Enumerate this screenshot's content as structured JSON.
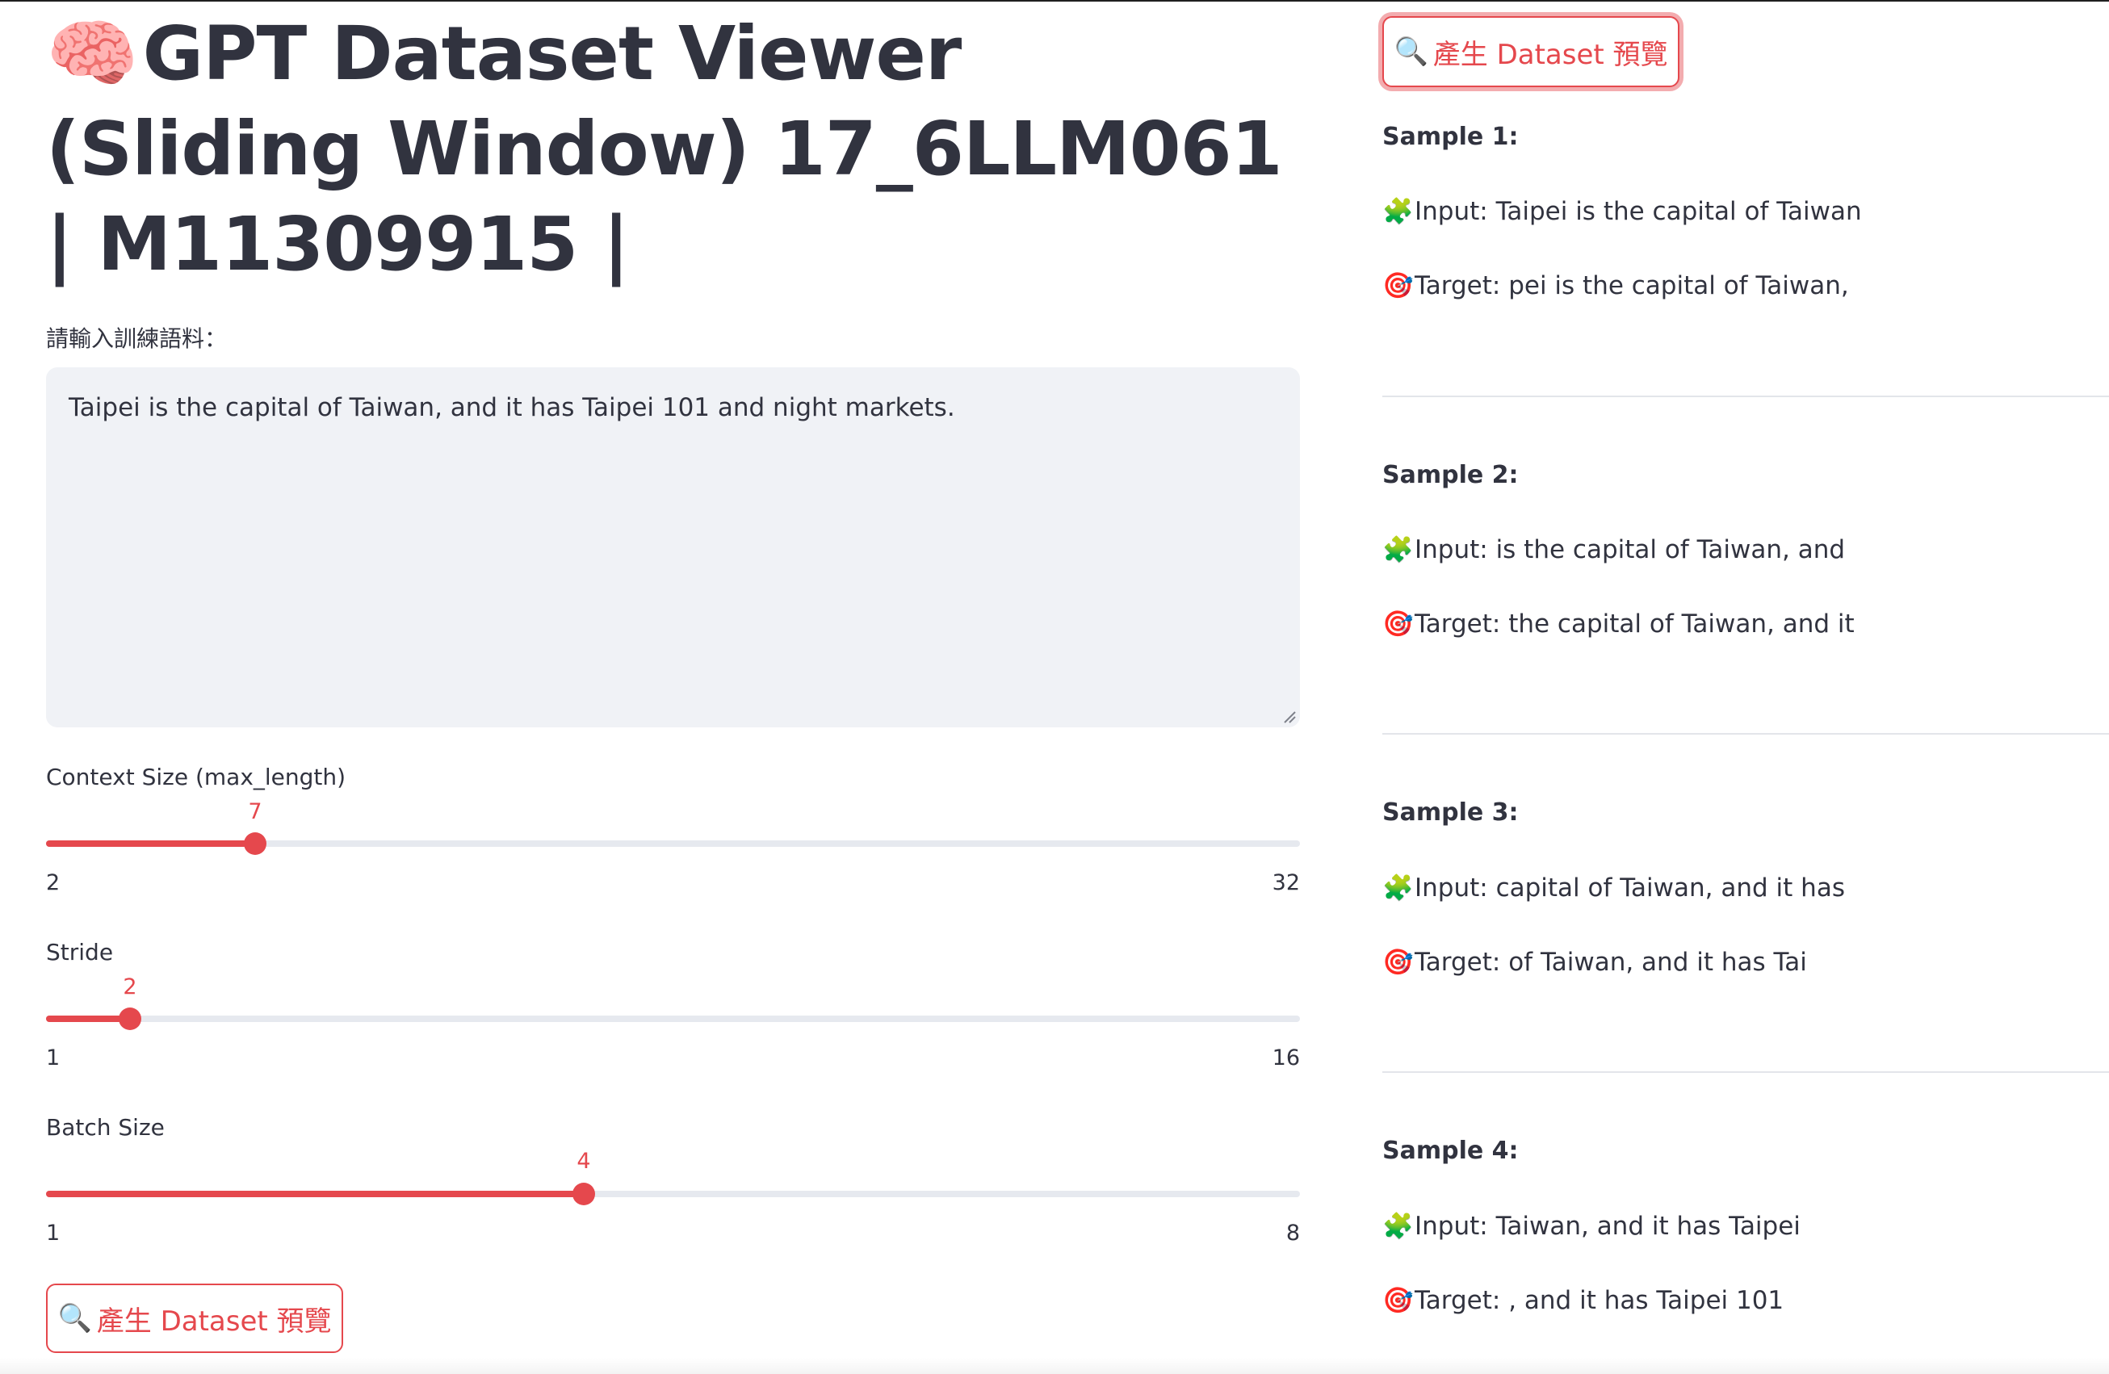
{
  "title": {
    "emoji": "🧠",
    "text": "GPT Dataset Viewer (Sliding Window) 17_6LLM061 | M11309915 |"
  },
  "input": {
    "label": "請輸入訓練語料：",
    "value": "Taipei is the capital of Taiwan, and it has Taipei 101 and night markets."
  },
  "sliders": [
    {
      "label": "Context Size (max_length)",
      "value": 7,
      "min": 2,
      "max": 32,
      "value_text": "7",
      "min_text": "2",
      "max_text": "32"
    },
    {
      "label": "Stride",
      "value": 2,
      "min": 1,
      "max": 16,
      "value_text": "2",
      "min_text": "1",
      "max_text": "16"
    },
    {
      "label": "Batch Size",
      "value": 4,
      "min": 1,
      "max": 8,
      "value_text": "4",
      "min_text": "1",
      "max_text": "8"
    }
  ],
  "buttons": {
    "generate_icon": "🔍",
    "generate_label": "產生 Dataset 預覽"
  },
  "samples": [
    {
      "title": "Sample 1:",
      "input": "Input: Taipei is the capital of Taiwan",
      "target": "Target: pei is the capital of Taiwan,"
    },
    {
      "title": "Sample 2:",
      "input": "Input: is the capital of Taiwan, and",
      "target": "Target: the capital of Taiwan, and it"
    },
    {
      "title": "Sample 3:",
      "input": "Input: capital of Taiwan, and it has",
      "target": "Target: of Taiwan, and it has Tai"
    },
    {
      "title": "Sample 4:",
      "input": "Input: Taiwan, and it has Taipei",
      "target": "Target: , and it has Taipei 101"
    }
  ],
  "icons": {
    "input": "🧩",
    "target": "🎯",
    "brain": "brain-icon",
    "search": "search-icon"
  },
  "colors": {
    "accent": "#e5484d",
    "text": "#31333f",
    "textarea_bg": "#f0f2f6",
    "track": "#e6e9ef"
  }
}
